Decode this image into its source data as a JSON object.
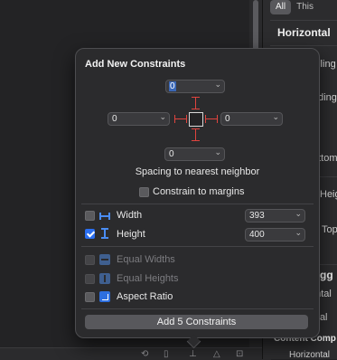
{
  "inspector": {
    "segments": [
      "All",
      "This"
    ],
    "section_title": "Horizontal",
    "rows": [
      "ailing",
      "ading",
      "l",
      "ottom",
      "Heig",
      "Top"
    ],
    "section_title2": "Hugg",
    "rows2": [
      "ontal",
      "ical"
    ],
    "section_title3": "Content Comp",
    "rows3": [
      "Horizontal"
    ]
  },
  "popover": {
    "title": "Add New Constraints",
    "spacing": {
      "top": "0",
      "left": "0",
      "right": "0",
      "bottom": "0"
    },
    "spacing_label": "Spacing to nearest neighbor",
    "constrain_to_margins": {
      "label": "Constrain to margins",
      "checked": false
    },
    "width": {
      "label": "Width",
      "value": "393",
      "checked": false
    },
    "height": {
      "label": "Height",
      "value": "400",
      "checked": true
    },
    "equal_widths": {
      "label": "Equal Widths",
      "checked": false,
      "enabled": false
    },
    "equal_heights": {
      "label": "Equal Heights",
      "checked": false,
      "enabled": false
    },
    "aspect_ratio": {
      "label": "Aspect Ratio",
      "checked": false
    },
    "add_button": "Add 5 Constraints"
  },
  "colors": {
    "accent": "#2a6ef0",
    "strut": "#e0443e",
    "popover_bg": "#2b2b2d"
  },
  "icons": [
    "chevron-down-icon",
    "width-icon",
    "height-icon",
    "equal-widths-icon",
    "equal-heights-icon",
    "aspect-ratio-icon",
    "checkmark-icon"
  ]
}
